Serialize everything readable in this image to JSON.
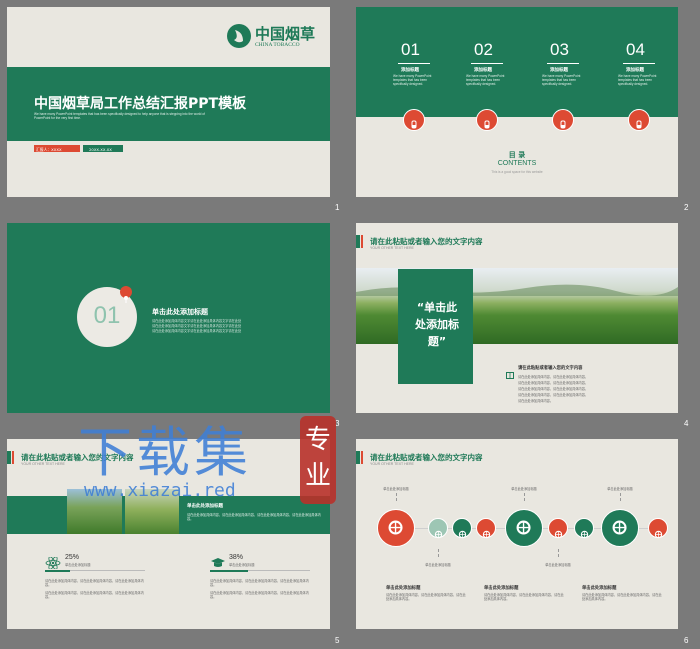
{
  "slides": {
    "s1": {
      "number": "1",
      "logo_cn": "中国烟草",
      "logo_en": "CHINA TOBACCO",
      "title": "中国烟草局工作总结汇报PPT模板",
      "desc": "We have many PowerPoint templates that has been specifically designed to help anyone that is stepping into the world of PowerPoint for the very first time.",
      "reporter": "汇报人：XXXX",
      "date": "20XX.XX.XX"
    },
    "s2": {
      "number": "2",
      "items": [
        {
          "num": "01",
          "title": "添加标题",
          "text": "We have many PowerPoint templates that has been specifically designed."
        },
        {
          "num": "02",
          "title": "添加标题",
          "text": "We have many PowerPoint templates that has been specifically designed."
        },
        {
          "num": "03",
          "title": "添加标题",
          "text": "We have many PowerPoint templates that has been specifically designed."
        },
        {
          "num": "04",
          "title": "添加标题",
          "text": "We have many PowerPoint templates that has been specifically designed."
        }
      ],
      "toc_cn": "目 录",
      "toc_en": "CONTENTS",
      "toc_sub": "This is a good space for this website"
    },
    "s3": {
      "number": "3",
      "circle_num": "01",
      "title": "单击此处添加标题",
      "lines": [
        "请在此处添加具体内容文字请在此处添加具体内容文字请在此处",
        "请在此处添加具体内容文字请在此处添加具体内容文字请在此处",
        "请在此处添加具体内容文字请在此处添加具体内容文字请在此处"
      ]
    },
    "s4": {
      "number": "4",
      "header": "请在此粘贴或者输入您的文字内容",
      "header_sub": "YOUR OTHER TEXT HERE",
      "box_text": "“单击此处添加标题”",
      "content_title": "请在此粘贴或者输入您的文字内容",
      "lines": [
        "请在此处添加具体内容，请在此处添加具体内容，",
        "请在此处添加具体内容，请在此处添加具体内容，",
        "请在此处添加具体内容，请在此处添加具体内容，",
        "请在此处添加具体内容，请在此处添加具体内容，",
        "请在此处添加具体内容。"
      ]
    },
    "s5": {
      "number": "5",
      "header": "请在此粘贴或者输入您的文字内容",
      "header_sub": "YOUR OTHER TEXT HERE",
      "bar_title": "单击此处添加标题",
      "bar_text": "请在此处添加具体内容，请在此处添加具体内容，请在此处添加具体内容，请在此处添加具体内容。",
      "stat1": {
        "value": "25%",
        "label": "单击此处添加标题"
      },
      "stat2": {
        "value": "38%",
        "label": "单击此处添加标题"
      },
      "progress1": 25,
      "progress2": 38
    },
    "s6": {
      "number": "6",
      "header": "请在此粘贴或者输入您的文字内容",
      "header_sub": "YOUR OTHER TEXT HERE",
      "top_label": "单击此处添加标题",
      "col_title": "单击此处添加标题",
      "col_text": "请在此处添加具体内容，请在此处添加具体内容，请在此处添加具体内容。"
    }
  },
  "watermark": {
    "cn": "下载集",
    "seal": "专业",
    "url": "www.xiazai.red"
  },
  "colors": {
    "green": "#1f7a58",
    "red": "#dd4a33",
    "paper": "#e9e7e0",
    "background": "#7a7a7a"
  }
}
